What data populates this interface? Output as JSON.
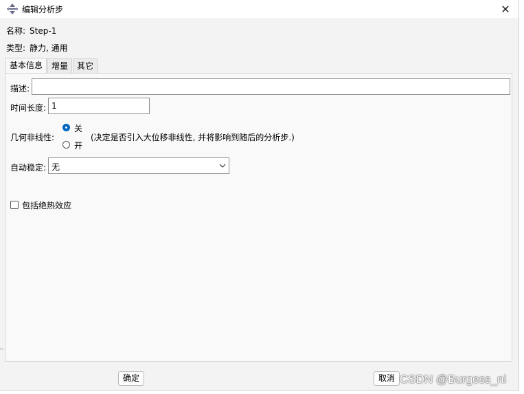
{
  "window": {
    "title": "编辑分析步",
    "close_glyph": "✕"
  },
  "info": {
    "name_label": "名称:",
    "name_value": "Step-1",
    "type_label": "类型:",
    "type_value": "静力, 通用"
  },
  "tabs": [
    {
      "label": "基本信息",
      "active": true
    },
    {
      "label": "增量",
      "active": false
    },
    {
      "label": "其它",
      "active": false
    }
  ],
  "basic": {
    "description_label": "描述:",
    "description_value": "",
    "time_period_label": "时间长度:",
    "time_period_value": "1",
    "nlgeom_label": "几何非线性:",
    "nlgeom_off_label": "关",
    "nlgeom_on_label": "开",
    "nlgeom_selected": "关",
    "nlgeom_note": "(决定是否引入大位移非线性, 并将影响到随后的分析步.)",
    "stabilization_label": "自动稳定:",
    "stabilization_value": "无",
    "adiabatic_label": "包括绝热效应",
    "adiabatic_checked": false
  },
  "footer": {
    "ok_label": "确定",
    "cancel_label": "取消"
  },
  "watermark": "CSDN @Burgess_ni",
  "colors": {
    "accent": "#0067c0",
    "panel_bg": "#f9f9f9",
    "window_bg": "#f3f3f3"
  }
}
